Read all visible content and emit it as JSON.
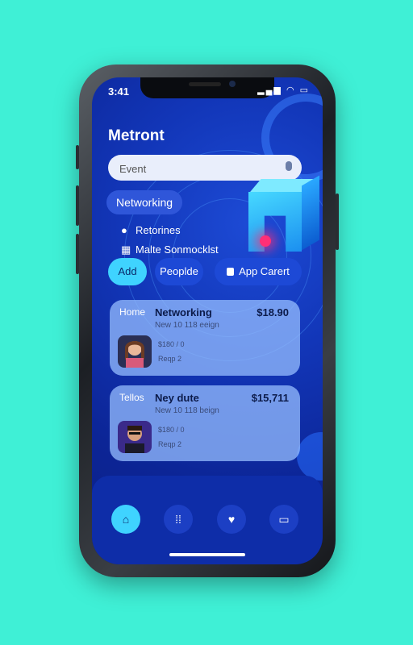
{
  "status": {
    "time": "3:41",
    "icons": "▂▄▆ ◠ ▭"
  },
  "app": {
    "title": "Metront"
  },
  "search": {
    "value": "Event",
    "mic_icon": "mic-icon"
  },
  "chip": {
    "label": "Networking"
  },
  "info": [
    {
      "icon": "location-pin-icon",
      "text": "Retorines"
    },
    {
      "icon": "calendar-icon",
      "text": "Malte Sonmocklst"
    }
  ],
  "actions": {
    "add": "Add",
    "people": "Peoplde",
    "app_cart": "App Carert"
  },
  "cards": [
    {
      "kind": "Home",
      "title": "Networking",
      "subtitle": "New 10 118 eeign",
      "price": "$18.90",
      "meta1": "$180 / 0",
      "meta2": "Reqp 2"
    },
    {
      "kind": "Tellos",
      "title": "Ney dute",
      "subtitle": "New 10 118 beign",
      "price": "$15,711",
      "meta1": "$180 / 0",
      "meta2": "Reqp 2"
    }
  ],
  "nav": [
    {
      "icon": "home-icon",
      "glyph": "⌂"
    },
    {
      "icon": "grid-icon",
      "glyph": "⁞⁞"
    },
    {
      "icon": "twitter-icon",
      "glyph": "♥"
    },
    {
      "icon": "message-icon",
      "glyph": "▭"
    }
  ],
  "colors": {
    "background": "#3ff0d6",
    "accent": "#3fd3ff",
    "screen": "#1236b8"
  }
}
